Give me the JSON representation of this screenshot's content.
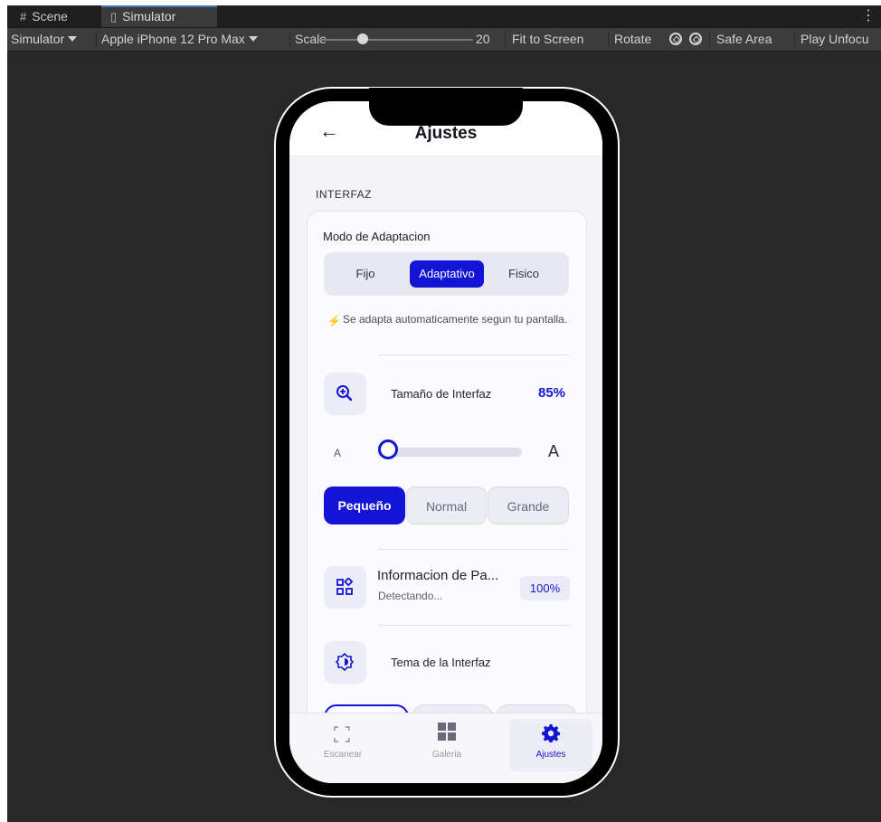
{
  "editor": {
    "tabs": [
      {
        "icon": "grid-icon",
        "label": "Scene"
      },
      {
        "icon": "device-icon",
        "label": "Simulator"
      }
    ],
    "toolbar": {
      "mode": "Simulator",
      "device": "Apple iPhone 12 Pro Max",
      "scale_label": "Scale",
      "scale_value": "20",
      "fit_to_screen": "Fit to Screen",
      "rotate": "Rotate",
      "safe_area": "Safe Area",
      "play_unfocused": "Play Unfocu"
    }
  },
  "app": {
    "title": "Ajustes",
    "section": "INTERFAZ",
    "adaptation": {
      "title": "Modo de Adaptacion",
      "options": [
        "Fijo",
        "Adaptativo",
        "Fisico"
      ],
      "selected": "Adaptativo",
      "hint": "Se adapta automaticamente segun tu pantalla."
    },
    "ui_size": {
      "label": "Tamaño de Interfaz",
      "value": "85%",
      "small_a": "A",
      "big_a": "A",
      "slider_fraction": 0.05,
      "presets": [
        "Pequeño",
        "Normal",
        "Grande"
      ],
      "selected_preset": "Pequeño"
    },
    "screen_info": {
      "title": "Informacion de Pa...",
      "subtitle": "Detectando...",
      "badge": "100%"
    },
    "theme": {
      "label": "Tema de la Interfaz"
    },
    "nav": [
      {
        "icon": "scan-icon",
        "label": "Escanear"
      },
      {
        "icon": "gallery-icon",
        "label": "Galeria"
      },
      {
        "icon": "settings-gear-icon",
        "label": "Ajustes"
      }
    ],
    "accent": "#1414d6"
  }
}
